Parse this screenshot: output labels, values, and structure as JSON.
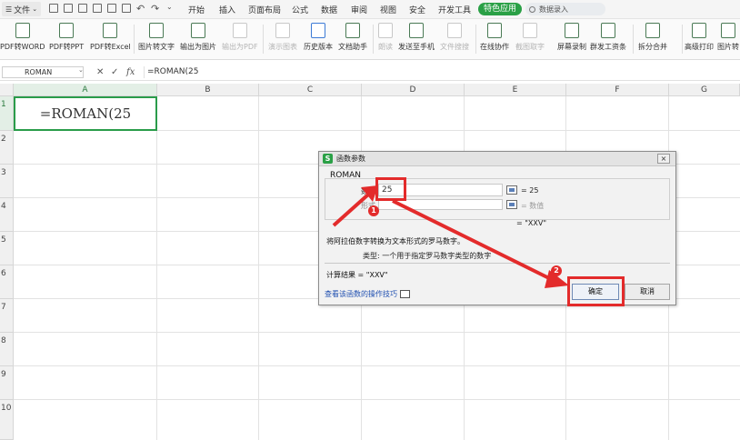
{
  "menubar": {
    "file": "文件",
    "tabs": [
      "开始",
      "插入",
      "页面布局",
      "公式",
      "数据",
      "审阅",
      "视图",
      "安全",
      "开发工具"
    ],
    "special": "特色应用",
    "search_placeholder": "数据录入"
  },
  "ribbon": {
    "buttons": [
      {
        "label": "PDF转WORD",
        "disabled": false
      },
      {
        "label": "PDF转PPT",
        "disabled": false
      },
      {
        "label": "PDF转Excel",
        "disabled": false
      },
      {
        "label": "图片转文字",
        "disabled": false
      },
      {
        "label": "输出为图片",
        "disabled": false
      },
      {
        "label": "输出为PDF",
        "disabled": true
      },
      {
        "label": "演示图表",
        "disabled": true
      },
      {
        "label": "历史版本",
        "disabled": false
      },
      {
        "label": "文档助手",
        "disabled": false
      },
      {
        "label": "朗读",
        "disabled": true
      },
      {
        "label": "发送至手机",
        "disabled": false
      },
      {
        "label": "文件搜搜",
        "disabled": true
      },
      {
        "label": "在线协作",
        "disabled": false
      },
      {
        "label": "截图取字",
        "disabled": true
      },
      {
        "label": "屏幕录制",
        "disabled": false
      },
      {
        "label": "群发工资条",
        "disabled": false
      },
      {
        "label": "拆分合并",
        "disabled": false
      },
      {
        "label": "高级打印",
        "disabled": false
      },
      {
        "label": "图片转",
        "disabled": false
      }
    ]
  },
  "formula_bar": {
    "name_box": "ROMAN",
    "formula": "=ROMAN(25"
  },
  "grid": {
    "columns": [
      "A",
      "B",
      "C",
      "D",
      "E",
      "F",
      "G"
    ],
    "rows": [
      "1",
      "2",
      "3",
      "4",
      "5",
      "6",
      "7",
      "8",
      "9",
      "10"
    ],
    "cell_a1": "=ROMAN(25"
  },
  "dialog": {
    "title": "函数参数",
    "function_name": "ROMAN",
    "arg1_label": "数值",
    "arg1_value": "25",
    "arg1_result": "= 25",
    "arg2_label": "形式",
    "arg2_result": "= 数值",
    "formula_result": "= \"XXV\"",
    "description": "将阿拉伯数字转换为文本形式的罗马数字。",
    "type_desc": "类型:   一个用于指定罗马数字类型的数字",
    "calc_result": "计算结果 = \"XXV\"",
    "help_link": "查看该函数的操作技巧",
    "ok": "确定",
    "cancel": "取消",
    "close": "×"
  },
  "annotations": {
    "badge1": "1",
    "badge2": "2",
    "color": "#e32b2b"
  }
}
